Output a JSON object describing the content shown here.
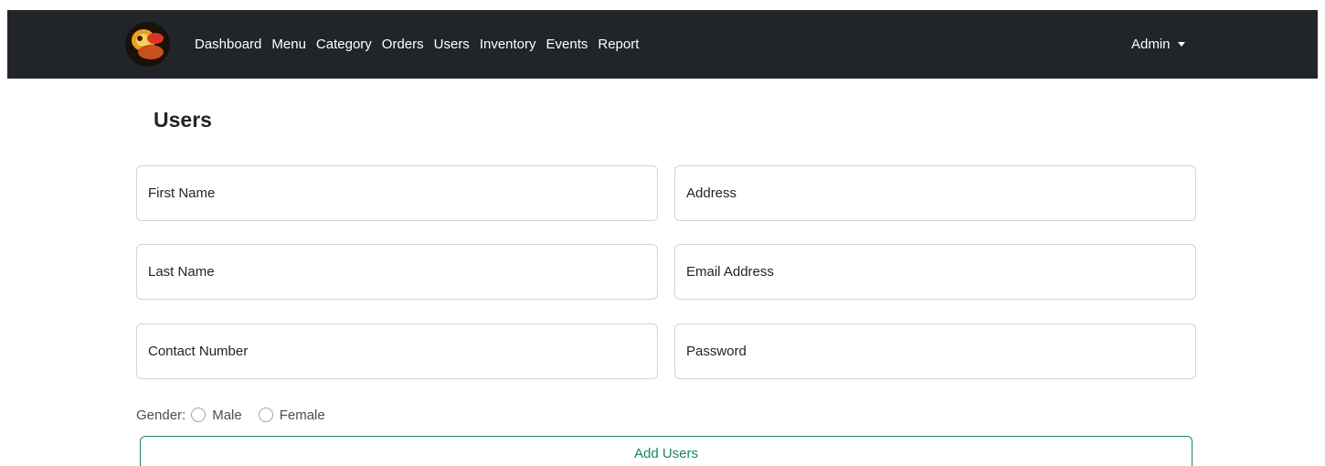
{
  "navbar": {
    "logo_name": "site-logo",
    "links": [
      "Dashboard",
      "Menu",
      "Category",
      "Orders",
      "Users",
      "Inventory",
      "Events",
      "Report"
    ],
    "account_label": "Admin"
  },
  "page": {
    "title": "Users"
  },
  "form": {
    "first_name_placeholder": "First Name",
    "address_placeholder": "Address",
    "last_name_placeholder": "Last Name",
    "email_placeholder": "Email Address",
    "contact_placeholder": "Contact Number",
    "password_placeholder": "Password",
    "gender_label": "Gender:",
    "gender_options": [
      "Male",
      "Female"
    ],
    "submit_label": "Add Users"
  },
  "colors": {
    "navbar_bg": "#212529",
    "success": "#198754"
  }
}
